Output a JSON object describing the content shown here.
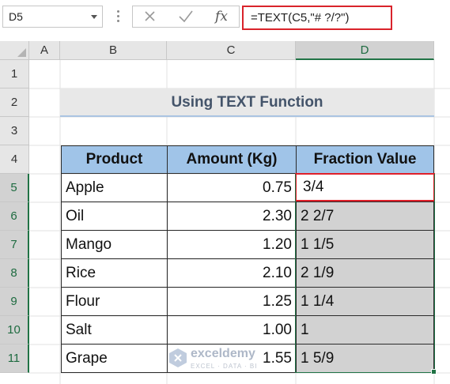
{
  "name_box": {
    "value": "D5"
  },
  "formula_bar": {
    "formula": "=TEXT(C5,\"# ?/?\")",
    "fx_label": "fx"
  },
  "columns": [
    "A",
    "B",
    "C",
    "D"
  ],
  "rows": [
    "1",
    "2",
    "3",
    "4",
    "5",
    "6",
    "7",
    "8",
    "9",
    "10",
    "11"
  ],
  "selected": {
    "column": "D",
    "rows": [
      "5",
      "6",
      "7",
      "8",
      "9",
      "10",
      "11"
    ]
  },
  "title": "Using TEXT Function",
  "table": {
    "headers": [
      "Product",
      "Amount (Kg)",
      "Fraction Value"
    ],
    "rows": [
      {
        "product": "Apple",
        "amount": "0.75",
        "fraction": "3/4"
      },
      {
        "product": "Oil",
        "amount": "2.30",
        "fraction": "2 2/7"
      },
      {
        "product": "Mango",
        "amount": "1.20",
        "fraction": "1 1/5"
      },
      {
        "product": "Rice",
        "amount": "2.10",
        "fraction": "2 1/9"
      },
      {
        "product": "Flour",
        "amount": "1.25",
        "fraction": "1 1/4"
      },
      {
        "product": "Salt",
        "amount": "1.00",
        "fraction": "1"
      },
      {
        "product": "Grape",
        "amount": "1.55",
        "fraction": "1 5/9"
      }
    ]
  },
  "watermark": {
    "name": "exceldemy",
    "tagline": "EXCEL · DATA · BI"
  },
  "colors": {
    "header_fill": "#a0c4e8",
    "selection_fill": "#d2d2d2",
    "highlight_red": "#d9232b",
    "excel_green": "#217346",
    "title_text": "#44546a"
  }
}
